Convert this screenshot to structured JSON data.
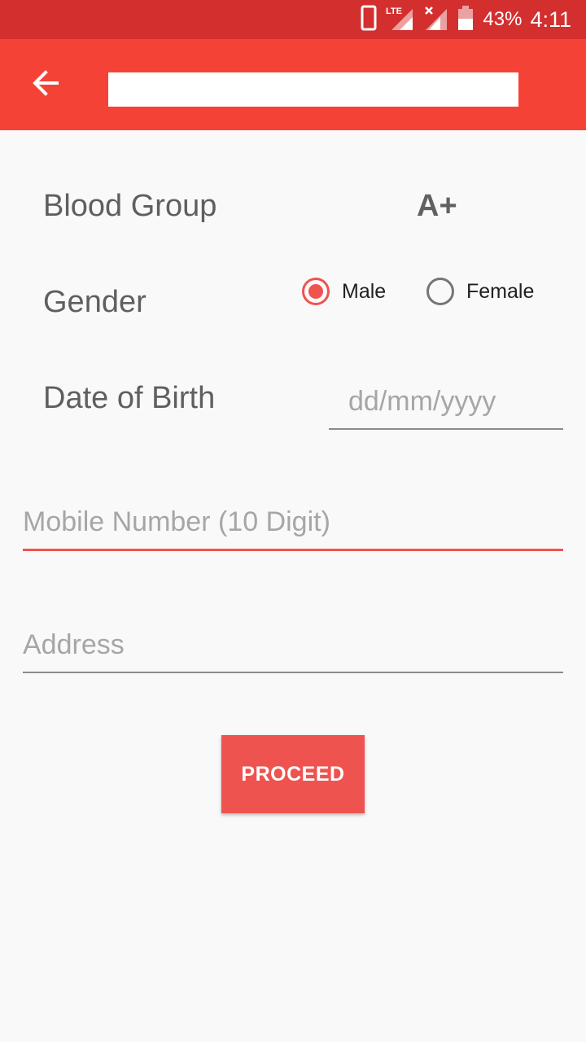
{
  "status_bar": {
    "battery_percent": "43%",
    "time": "4:11",
    "network": "LTE",
    "background_color": "#d32f2f",
    "icons": [
      "phone-icon",
      "lte-signal-icon",
      "no-signal-icon",
      "battery-icon"
    ]
  },
  "app_bar": {
    "background_color": "#f44336",
    "back_icon": "back-arrow-icon",
    "title_value": ""
  },
  "form": {
    "blood_group": {
      "label": "Blood Group",
      "value": "A+"
    },
    "gender": {
      "label": "Gender",
      "options": [
        {
          "label": "Male",
          "selected": true
        },
        {
          "label": "Female",
          "selected": false
        }
      ]
    },
    "dob": {
      "label": "Date of Birth",
      "placeholder": "dd/mm/yyyy",
      "value": ""
    },
    "mobile": {
      "placeholder": "Mobile Number (10 Digit)",
      "value": ""
    },
    "address": {
      "placeholder": "Address",
      "value": ""
    },
    "proceed_label": "PROCEED"
  },
  "colors": {
    "accent": "#ef5350",
    "text": "#5f5f5f"
  }
}
